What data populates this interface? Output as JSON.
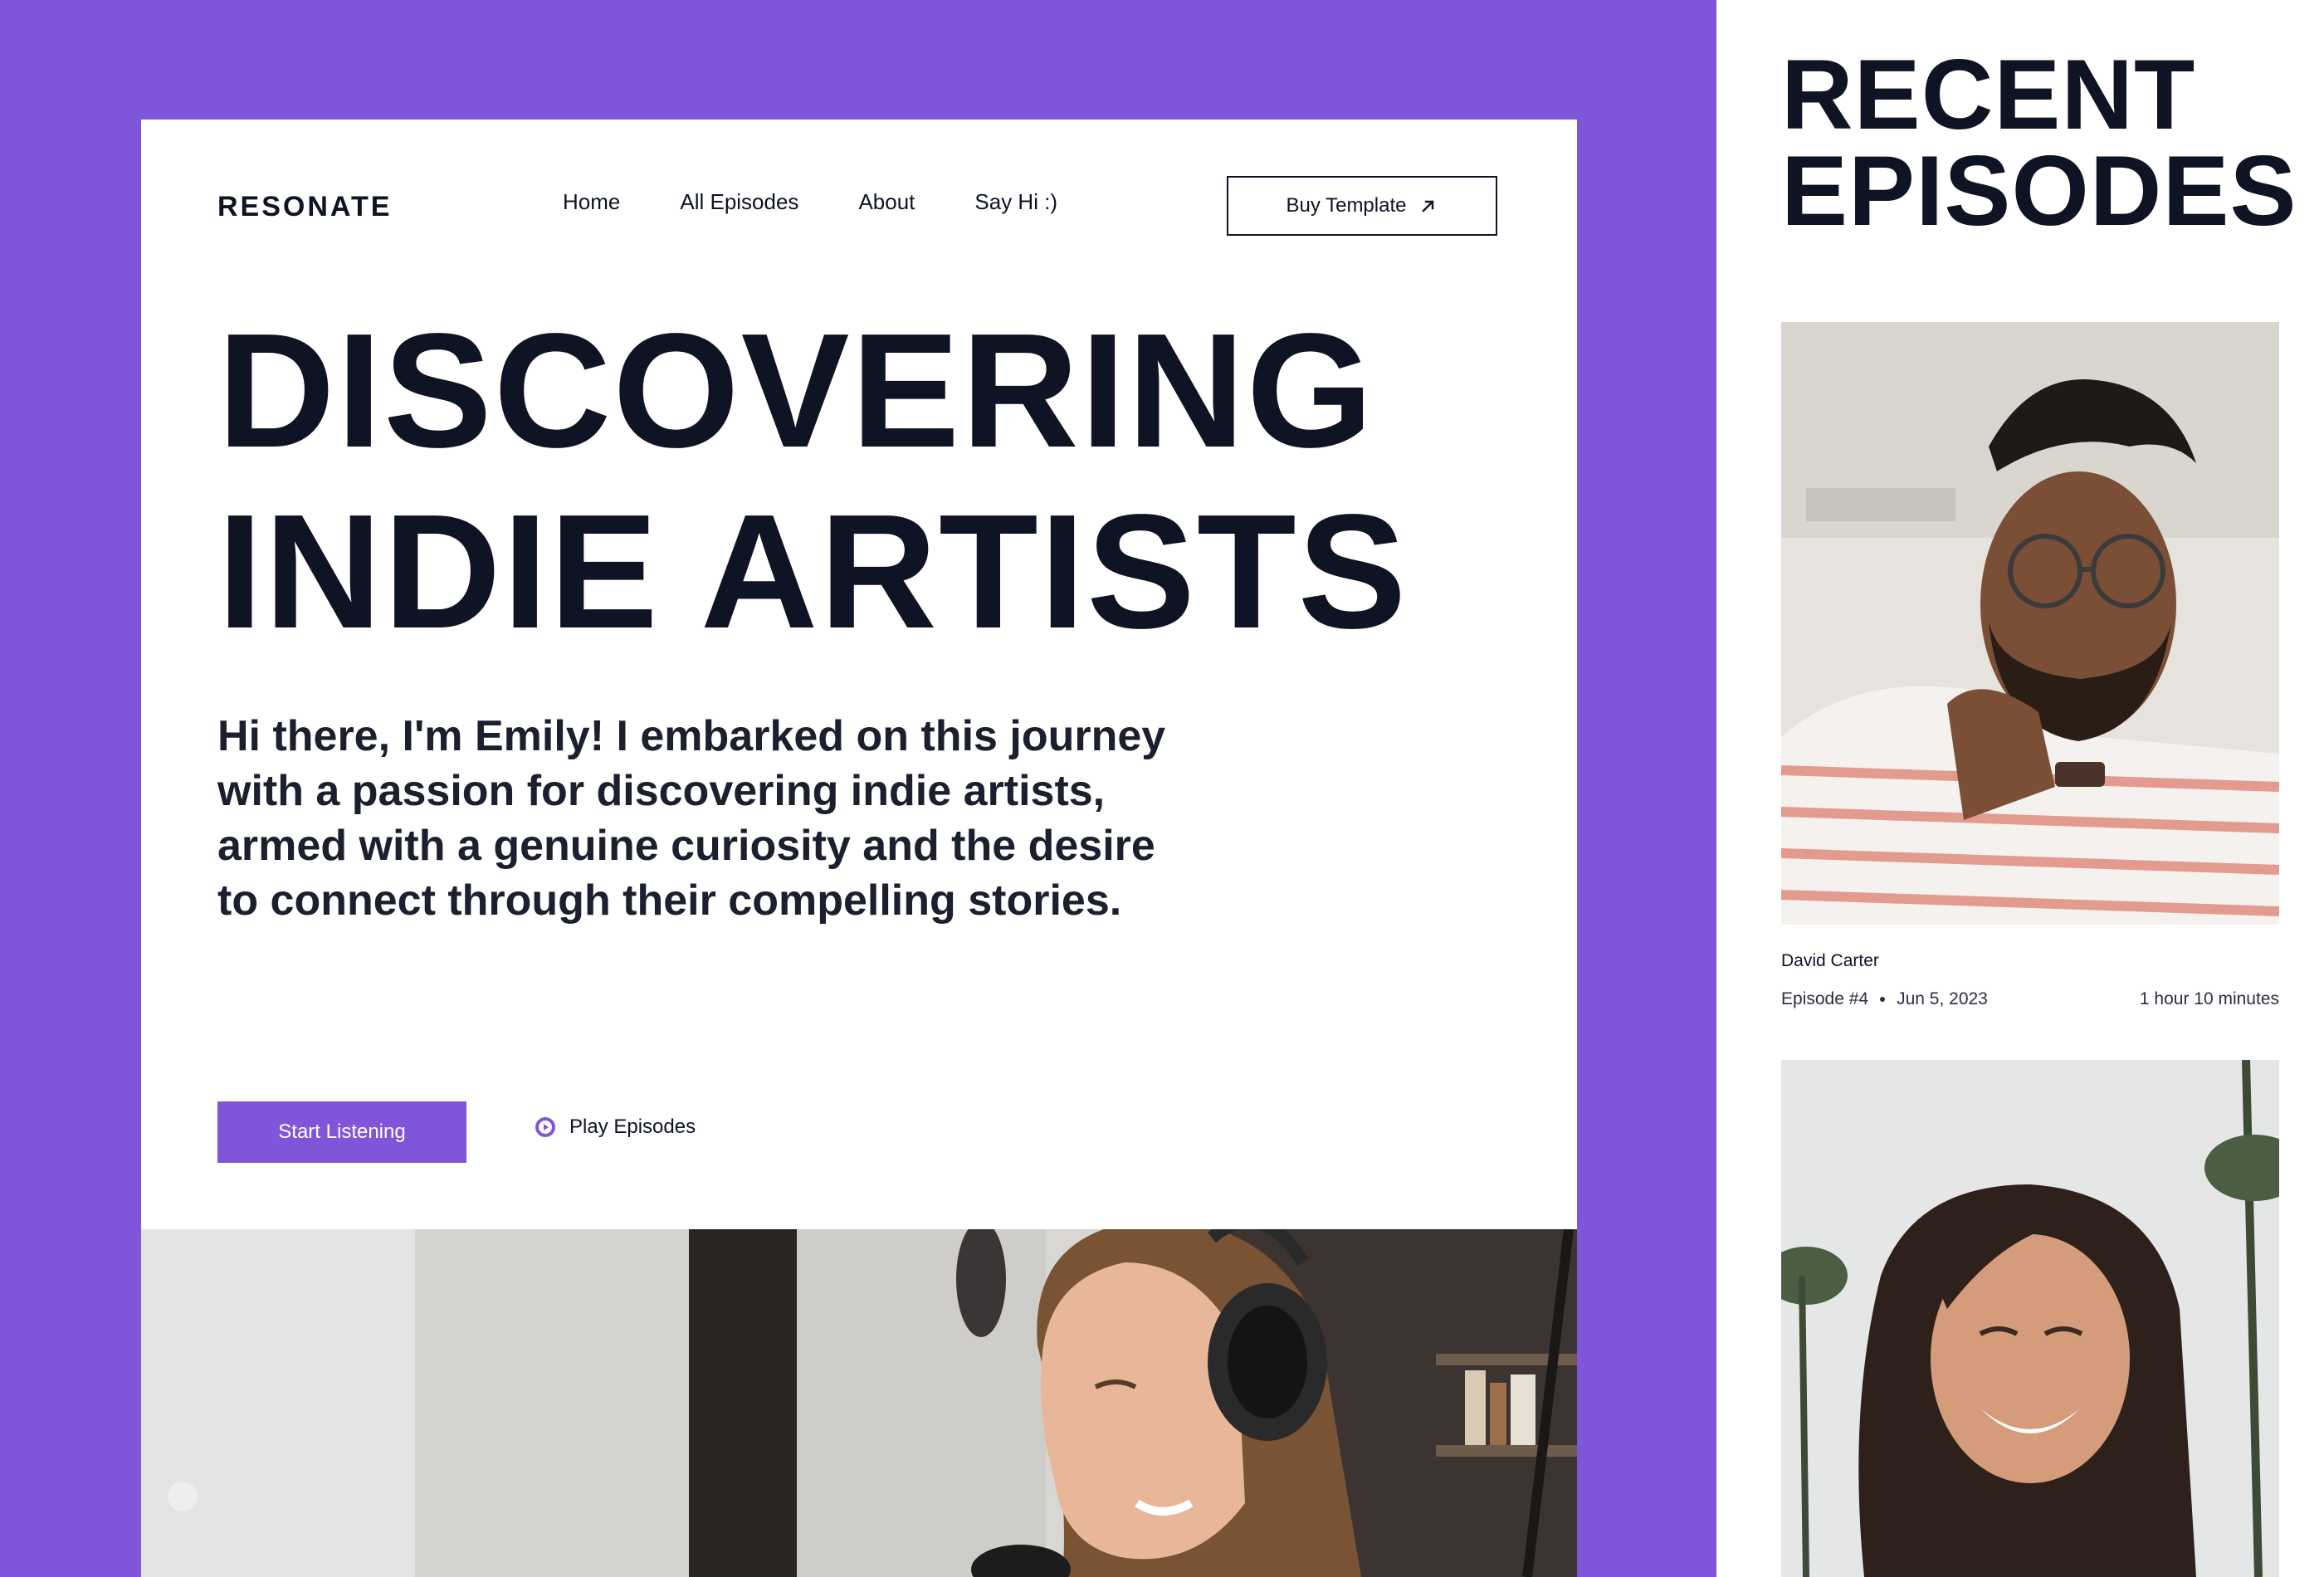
{
  "brand": {
    "logo": "RESONATE"
  },
  "nav": {
    "items": [
      {
        "label": "Home"
      },
      {
        "label": "All Episodes"
      },
      {
        "label": "About"
      },
      {
        "label": "Say Hi :)"
      }
    ],
    "buy_label": "Buy Template",
    "buy_icon": "arrow-up-right-icon"
  },
  "hero": {
    "title_line1": "DISCOVERING",
    "title_line2": "INDIE ARTISTS",
    "intro": "Hi there, I'm Emily! I embarked on this journey with a passion for discovering indie artists, armed with a genuine curiosity and the desire to connect through their compelling stories.",
    "start_label": "Start Listening",
    "play_label": "Play Episodes",
    "play_icon": "play-circle-icon"
  },
  "recent": {
    "title_line1": "RECENT",
    "title_line2": "EPISODES",
    "episodes": [
      {
        "guest": "David Carter",
        "number": "Episode #4",
        "date": "Jun 5, 2023",
        "duration": "1 hour 10 minutes"
      }
    ]
  },
  "colors": {
    "accent": "#7f56d9",
    "text": "#0f1424",
    "background": "#ffffff"
  }
}
